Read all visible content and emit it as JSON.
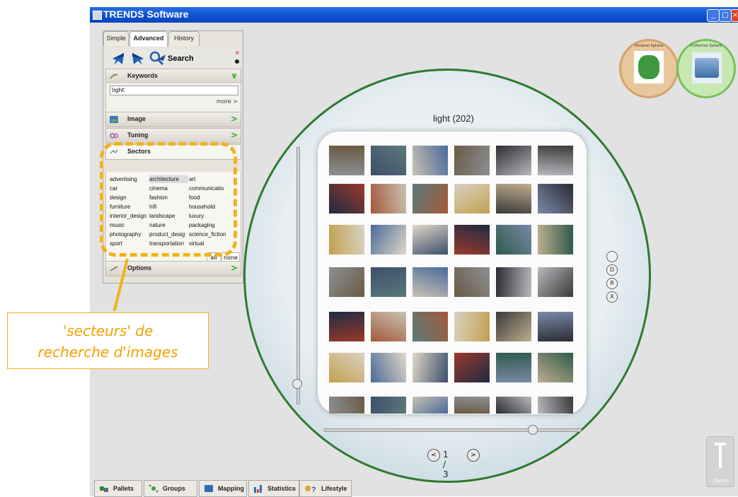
{
  "window": {
    "title": "TRENDS Software"
  },
  "panel": {
    "tabs": [
      "Simple",
      "Advanced",
      "History"
    ],
    "active_tab": "Advanced",
    "search_label": "Search",
    "keywords": {
      "label": "Keywords",
      "value": "light",
      "more": "more >"
    },
    "sections": {
      "image": "Image",
      "tuning": "Tuning",
      "sectors": "Sectors",
      "options": "Options"
    },
    "sectors": [
      [
        "advertising",
        "architecture",
        "art"
      ],
      [
        "car",
        "cinema",
        "communicatio"
      ],
      [
        "design",
        "fashion",
        "food"
      ],
      [
        "furniture",
        "hifi",
        "household"
      ],
      [
        "interior_design",
        "landscape",
        "luxury"
      ],
      [
        "music",
        "nature",
        "packaging"
      ],
      [
        "photography",
        "product_desig",
        "science_fiction"
      ],
      [
        "sport",
        "transportation",
        "virtual"
      ]
    ],
    "selected_sector": "architecture",
    "all_label": "all",
    "none_label": "none"
  },
  "annotation": {
    "line1": "'secteurs' de",
    "line2": "recherche d'images",
    "color": "#f2a200"
  },
  "results": {
    "query_label": "light (202)",
    "page": "1 / 3"
  },
  "side_buttons": [
    "",
    "D",
    "R",
    "X"
  ],
  "spheres": {
    "personal": "Personal Sphere",
    "collective": "Collective Sphere"
  },
  "zoom": {
    "label": "Zoom"
  },
  "bottom_tabs": [
    "Pallets",
    "Groups",
    "Mapping",
    "Statistics",
    "Lifestyle"
  ],
  "colors": {
    "accent": "#f2b21a",
    "sphere_border": "#2e7a2e",
    "titlebar": "#0b4fd0"
  }
}
